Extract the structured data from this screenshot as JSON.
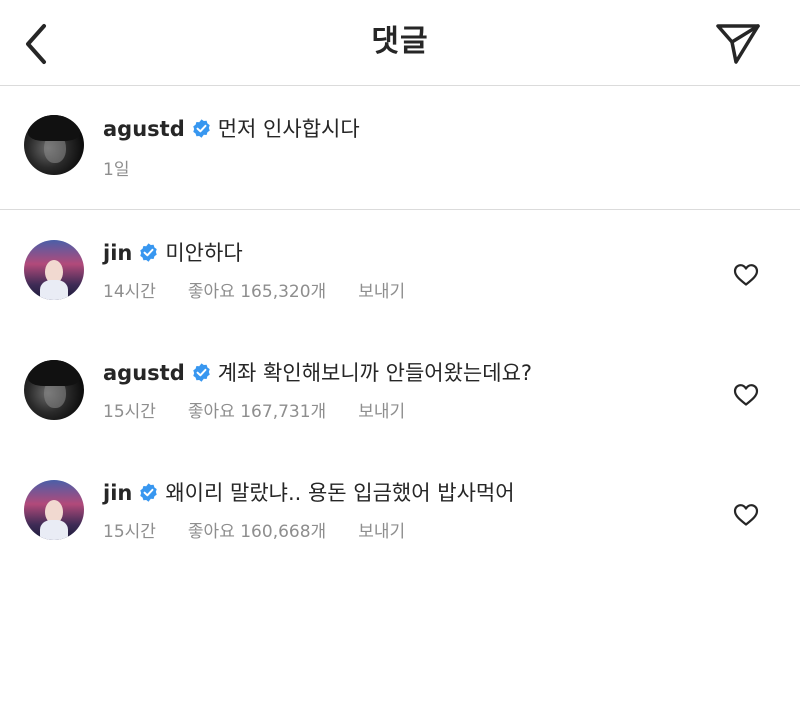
{
  "header": {
    "title": "댓글",
    "back_icon": "chevron-left-icon",
    "send_icon": "paper-plane-icon"
  },
  "caption": {
    "username": "agustd",
    "verified": true,
    "text": "먼저 인사합시다",
    "time": "1일"
  },
  "comments": [
    {
      "username": "jin",
      "verified": true,
      "text": "미안하다",
      "time": "14시간",
      "likes": "좋아요 165,320개",
      "reply_label": "보내기"
    },
    {
      "username": "agustd",
      "verified": true,
      "text": "계좌 확인해보니까 안들어왔는데요?",
      "time": "15시간",
      "likes": "좋아요 167,731개",
      "reply_label": "보내기"
    },
    {
      "username": "jin",
      "verified": true,
      "text": "왜이리 말랐냐.. 용돈 입금했어 밥사먹어",
      "time": "15시간",
      "likes": "좋아요 160,668개",
      "reply_label": "보내기"
    }
  ],
  "colors": {
    "text": "#262626",
    "secondary": "#8e8e8e",
    "divider": "#dbdbdb",
    "verified_blue": "#3897f0"
  }
}
